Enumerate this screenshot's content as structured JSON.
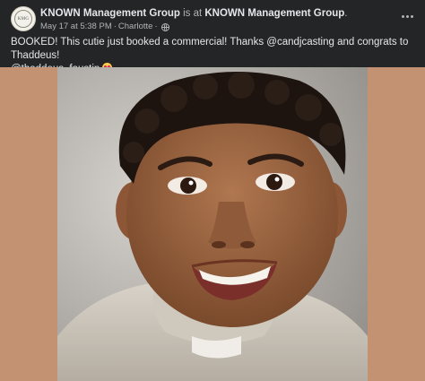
{
  "post": {
    "page_name": "KNOWN Management Group",
    "is_at_text": " is at ",
    "location_name": "KNOWN Management Group",
    "period": ".",
    "timestamp": "May 17 at 5:38 PM",
    "separator": "·",
    "place": "Charlotte",
    "avatar_text": "KMG",
    "caption_main": "BOOKED! This cutie just booked a commercial! Thanks @candjcasting and congrats to Thaddeus!",
    "caption_mention": "@thaddeus_faustin",
    "privacy_icon": "globe-icon",
    "caption_emoji": "star-struck-emoji-icon",
    "menu_icon": "more-options-icon"
  },
  "colors": {
    "background": "#242526",
    "photo_matte": "#c39273",
    "text_primary": "#e4e6eb",
    "text_secondary": "#b0b3b8"
  }
}
